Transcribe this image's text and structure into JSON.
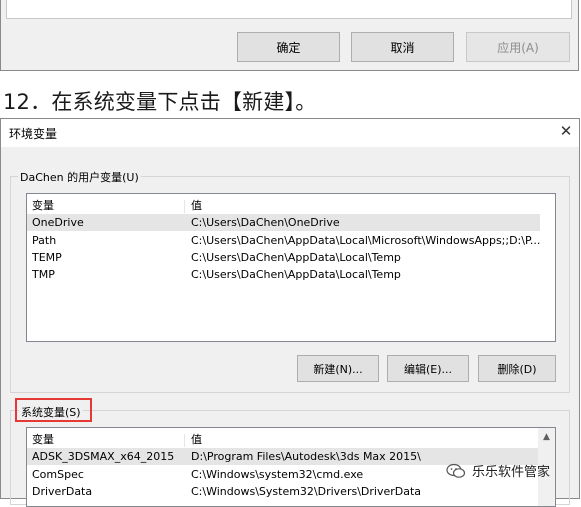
{
  "prev_dialog": {
    "ok_label": "确定",
    "cancel_label": "取消",
    "apply_label": "应用(A)"
  },
  "caption": "12．在系统变量下点击【新建】。",
  "env_dialog": {
    "title": "环境变量",
    "user_group_label": "DaChen 的用户变量(U)",
    "user_columns": [
      "变量",
      "值"
    ],
    "user_rows": [
      {
        "name": "OneDrive",
        "value": "C:\\Users\\DaChen\\OneDrive"
      },
      {
        "name": "Path",
        "value": "C:\\Users\\DaChen\\AppData\\Local\\Microsoft\\WindowsApps;;D:\\P..."
      },
      {
        "name": "TEMP",
        "value": "C:\\Users\\DaChen\\AppData\\Local\\Temp"
      },
      {
        "name": "TMP",
        "value": "C:\\Users\\DaChen\\AppData\\Local\\Temp"
      }
    ],
    "new_label": "新建(N)...",
    "edit_label": "编辑(E)...",
    "delete_label": "删除(D)",
    "system_group_label": "系统变量(S)",
    "system_columns": [
      "变量",
      "值"
    ],
    "system_rows": [
      {
        "name": "ADSK_3DSMAX_x64_2015",
        "value": "D:\\Program Files\\Autodesk\\3ds Max 2015\\"
      },
      {
        "name": "ComSpec",
        "value": "C:\\Windows\\system32\\cmd.exe"
      },
      {
        "name": "DriverData",
        "value": "C:\\Windows\\System32\\Drivers\\DriverData"
      }
    ]
  },
  "watermark": "乐乐软件管家",
  "colors": {
    "highlight": "#e53935",
    "dialog_bg": "#f0f0f0"
  }
}
